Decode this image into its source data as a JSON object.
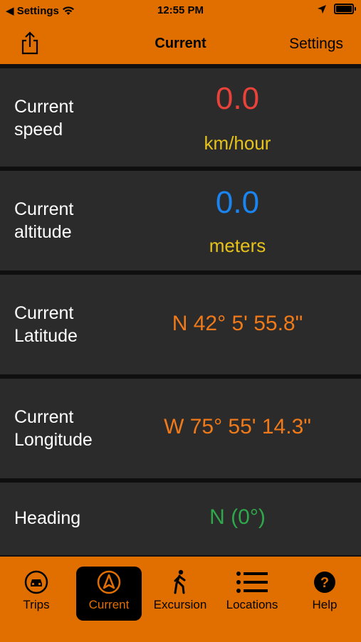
{
  "status": {
    "back_label": "◀ Settings",
    "time": "12:55 PM"
  },
  "nav": {
    "title": "Current",
    "settings_label": "Settings"
  },
  "rows": [
    {
      "label": "Current\nspeed",
      "value": "0.0",
      "unit": "km/hour",
      "value_color": "#e8423a"
    },
    {
      "label": "Current\naltitude",
      "value": "0.0",
      "unit": "meters",
      "value_color": "#1a84f0"
    },
    {
      "label": "Current\nLatitude",
      "value": "N 42° 5' 55.8\"",
      "value_color": "#f07a1a"
    },
    {
      "label": "Current\nLongitude",
      "value": "W 75° 55' 14.3\"",
      "value_color": "#f07a1a"
    },
    {
      "label": "Heading",
      "value": "N (0°)",
      "value_color": "#2ea84a"
    }
  ],
  "tabs": [
    {
      "label": "Trips",
      "icon": "car-icon"
    },
    {
      "label": "Current",
      "icon": "compass-arrow-icon",
      "active": true
    },
    {
      "label": "Excursion",
      "icon": "walking-person-icon"
    },
    {
      "label": "Locations",
      "icon": "list-icon"
    },
    {
      "label": "Help",
      "icon": "help-icon"
    }
  ],
  "colors": {
    "accent": "#e06f00",
    "row_bg": "#2b2b2b",
    "unit_yellow": "#e6c21b"
  }
}
